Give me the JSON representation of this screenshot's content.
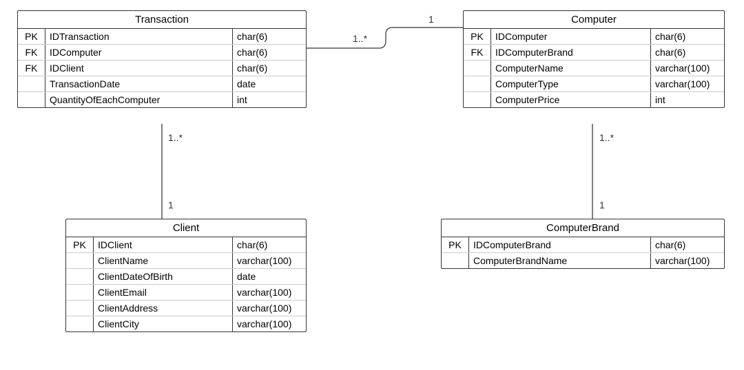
{
  "entities": {
    "transaction": {
      "title": "Transaction",
      "attrs": [
        {
          "key": "PK",
          "name": "IDTransaction",
          "type": "char(6)"
        },
        {
          "key": "FK",
          "name": "IDComputer",
          "type": "char(6)"
        },
        {
          "key": "FK",
          "name": "IDClient",
          "type": "char(6)"
        },
        {
          "key": "",
          "name": "TransactionDate",
          "type": "date"
        },
        {
          "key": "",
          "name": "QuantityOfEachComputer",
          "type": "int"
        }
      ]
    },
    "computer": {
      "title": "Computer",
      "attrs": [
        {
          "key": "PK",
          "name": "IDComputer",
          "type": "char(6)"
        },
        {
          "key": "FK",
          "name": "IDComputerBrand",
          "type": "char(6)"
        },
        {
          "key": "",
          "name": "ComputerName",
          "type": "varchar(100)"
        },
        {
          "key": "",
          "name": "ComputerType",
          "type": "varchar(100)"
        },
        {
          "key": "",
          "name": "ComputerPrice",
          "type": "int"
        }
      ]
    },
    "client": {
      "title": "Client",
      "attrs": [
        {
          "key": "PK",
          "name": "IDClient",
          "type": "char(6)"
        },
        {
          "key": "",
          "name": "ClientName",
          "type": "varchar(100)"
        },
        {
          "key": "",
          "name": "ClientDateOfBirth",
          "type": "date"
        },
        {
          "key": "",
          "name": "ClientEmail",
          "type": "varchar(100)"
        },
        {
          "key": "",
          "name": "ClientAddress",
          "type": "varchar(100)"
        },
        {
          "key": "",
          "name": "ClientCity",
          "type": "varchar(100)"
        }
      ]
    },
    "computerbrand": {
      "title": "ComputerBrand",
      "attrs": [
        {
          "key": "PK",
          "name": "IDComputerBrand",
          "type": "char(6)"
        },
        {
          "key": "",
          "name": "ComputerBrandName",
          "type": "varchar(100)"
        }
      ]
    }
  },
  "cardinalities": {
    "trans_comp_left": "1..*",
    "trans_comp_right": "1",
    "trans_client_top": "1..*",
    "trans_client_bottom": "1",
    "comp_brand_top": "1..*",
    "comp_brand_bottom": "1"
  }
}
